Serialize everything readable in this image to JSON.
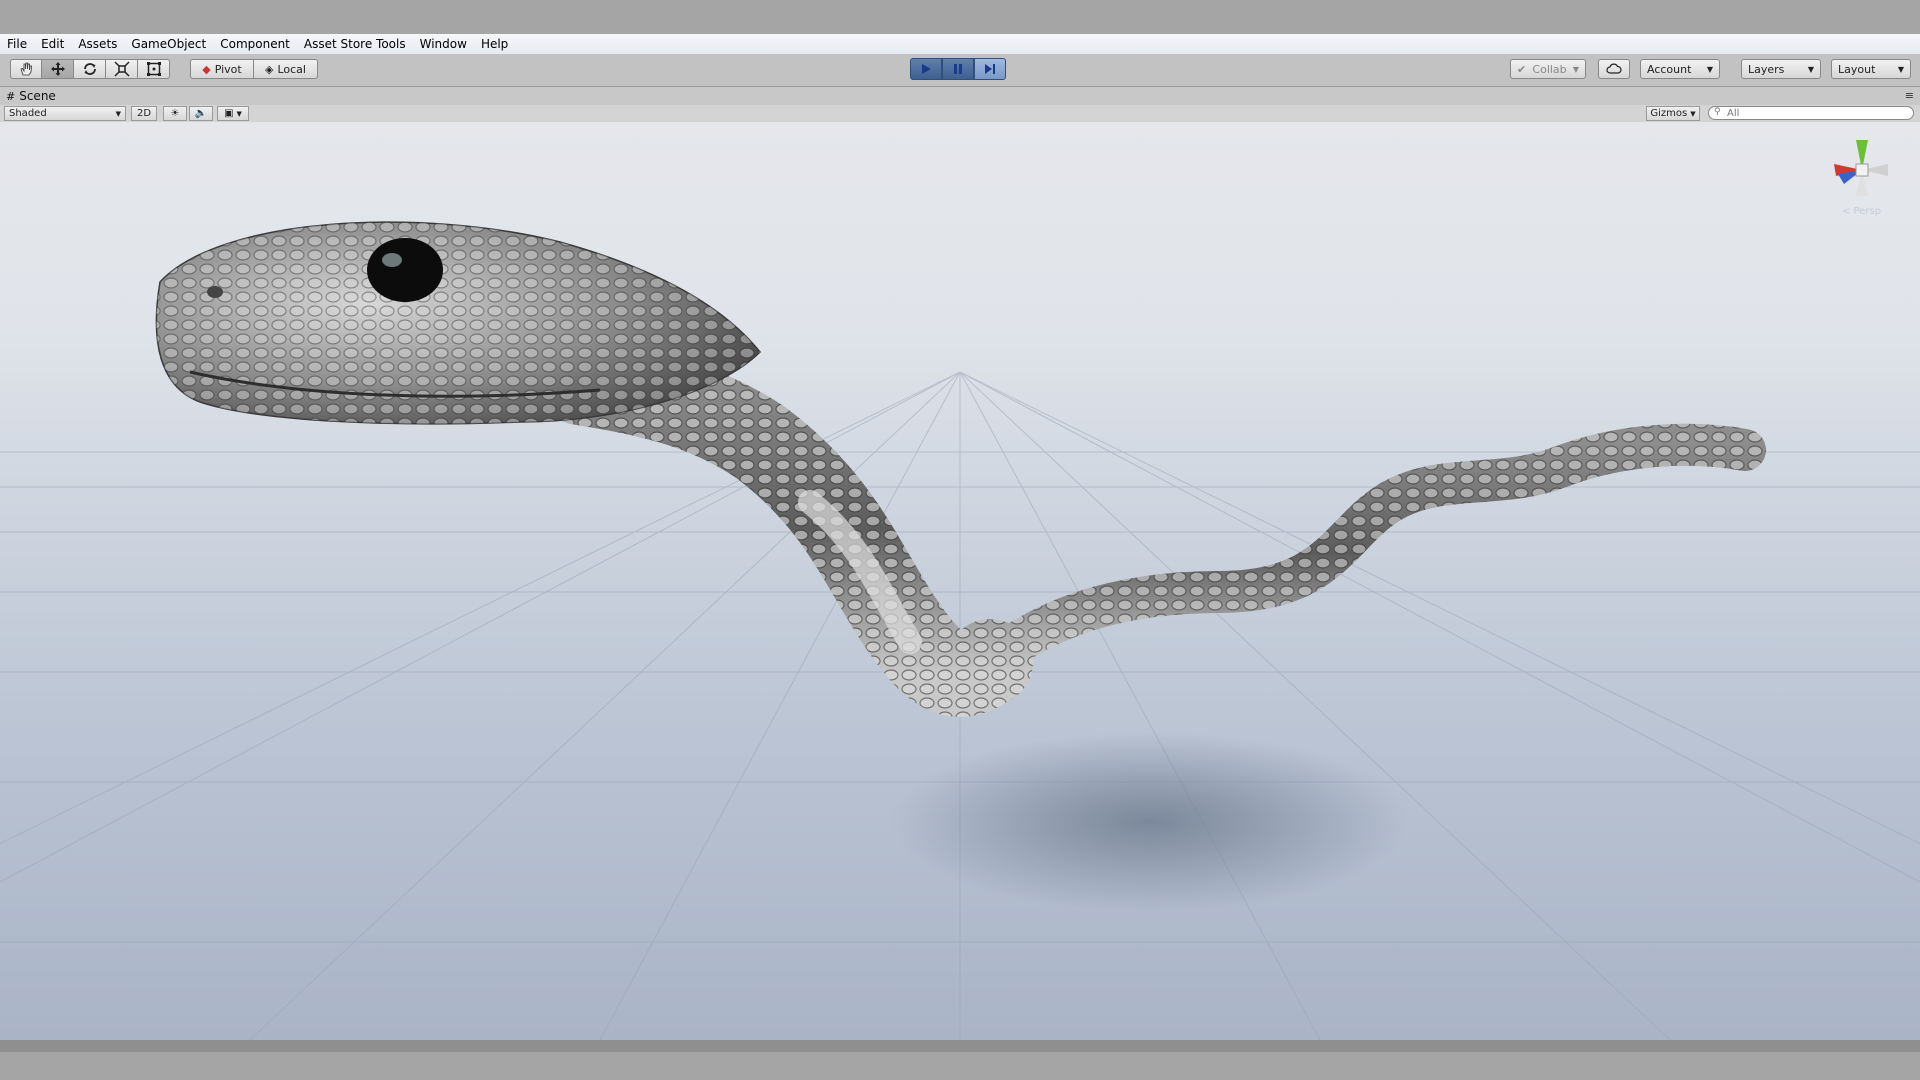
{
  "menu": [
    "File",
    "Edit",
    "Assets",
    "GameObject",
    "Component",
    "Asset Store Tools",
    "Window",
    "Help"
  ],
  "toolbar": {
    "transform_tools": [
      "hand-icon",
      "move-icon",
      "rotate-icon",
      "scale-icon",
      "rect-tool-icon"
    ],
    "pivot_label": "Pivot",
    "local_label": "Local",
    "collab_label": "Collab",
    "account_label": "Account",
    "layers_label": "Layers",
    "layout_label": "Layout",
    "accent_play": "#4f6fa0"
  },
  "scene": {
    "tab_label": "Scene",
    "shading_mode": "Shaded",
    "toggle_2d": "2D",
    "gizmos_label": "Gizmos",
    "search_placeholder": "All",
    "persp_label": "< Persp"
  }
}
